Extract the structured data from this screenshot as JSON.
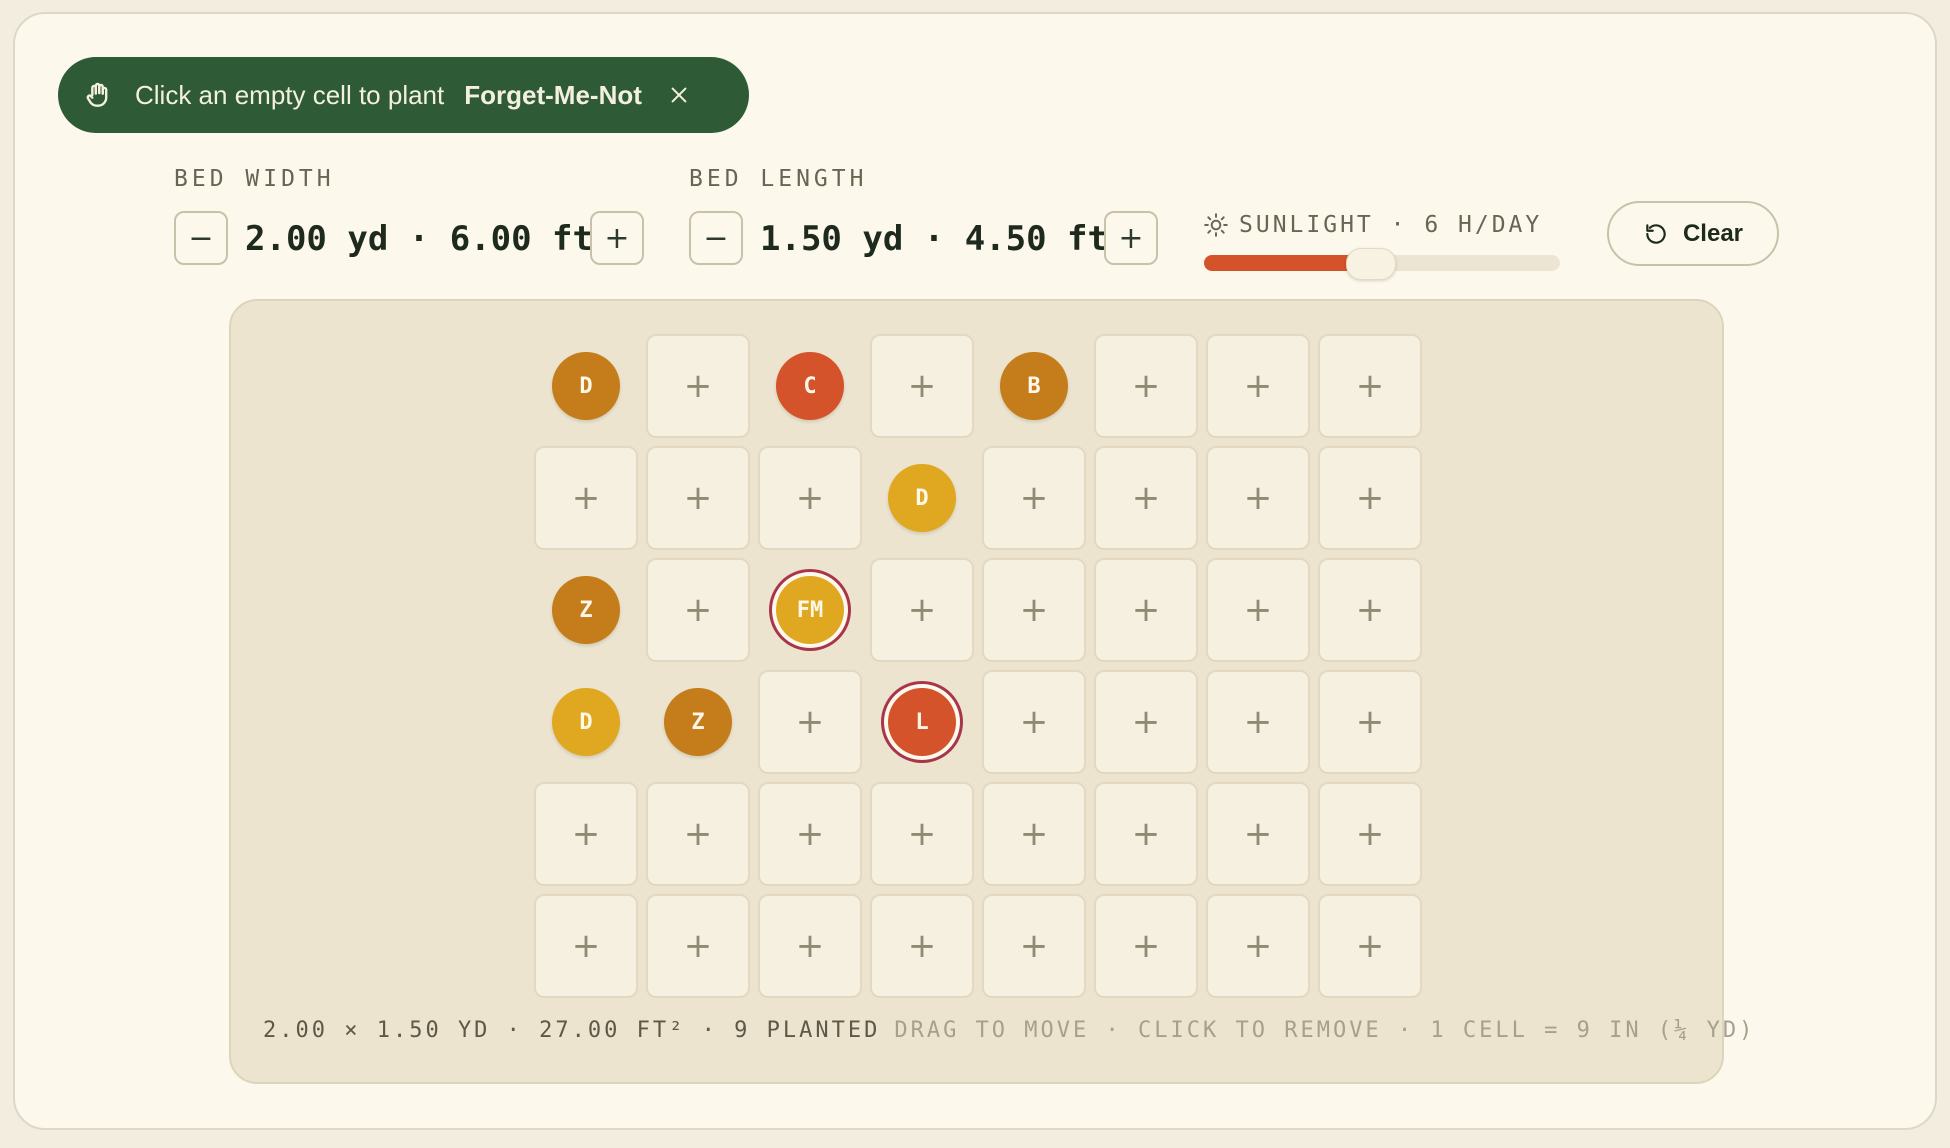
{
  "toast": {
    "message": "Click an empty cell to plant",
    "plant_name": "Forget-Me-Not",
    "hand_icon": "hand-icon",
    "close_icon": "close-icon"
  },
  "bed_width": {
    "label": "BED WIDTH",
    "value": "2.00 yd · 6.00 ft",
    "decrement": "−",
    "increment": "+"
  },
  "bed_length": {
    "label": "BED LENGTH",
    "value": "1.50 yd · 4.50 ft",
    "decrement": "−",
    "increment": "+"
  },
  "sunlight": {
    "label": "SUNLIGHT · 6 H/DAY",
    "icon": "sun-icon",
    "hours": 6,
    "max_hours": 16
  },
  "clear_button": {
    "label": "Clear",
    "icon": "reset-icon"
  },
  "grid": {
    "columns": 8,
    "rows": 6,
    "empty_symbol": "+",
    "plants": [
      {
        "row": 0,
        "col": 0,
        "label": "D",
        "color": "#c47d1a",
        "selected": false
      },
      {
        "row": 0,
        "col": 2,
        "label": "C",
        "color": "#d4532a",
        "selected": false
      },
      {
        "row": 0,
        "col": 4,
        "label": "B",
        "color": "#c47d1a",
        "selected": false
      },
      {
        "row": 1,
        "col": 3,
        "label": "D",
        "color": "#e0a820",
        "selected": false
      },
      {
        "row": 2,
        "col": 0,
        "label": "Z",
        "color": "#c47d1a",
        "selected": false
      },
      {
        "row": 2,
        "col": 2,
        "label": "FM",
        "color": "#e0a820",
        "selected": true
      },
      {
        "row": 3,
        "col": 0,
        "label": "D",
        "color": "#e0a820",
        "selected": false
      },
      {
        "row": 3,
        "col": 1,
        "label": "Z",
        "color": "#c47d1a",
        "selected": false
      },
      {
        "row": 3,
        "col": 3,
        "label": "L",
        "color": "#d4532a",
        "selected": true
      }
    ]
  },
  "footer": {
    "stats": "2.00 × 1.50 YD · 27.00 FT² · 9 PLANTED",
    "hint": "DRAG TO MOVE · CLICK TO REMOVE · 1 CELL = 9 IN (¼ YD)"
  },
  "colors": {
    "accent_green": "#2e5a36",
    "accent_orange": "#d4532a",
    "selected_ring": "#a8354a"
  }
}
